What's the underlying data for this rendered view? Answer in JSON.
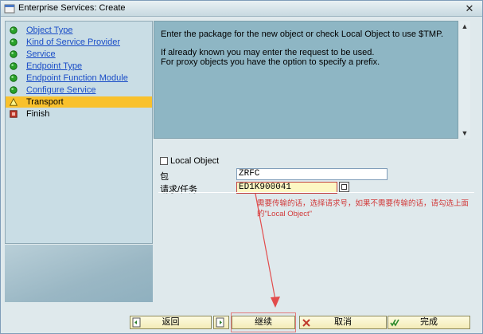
{
  "window": {
    "title": "Enterprise Services: Create",
    "close_glyph": "✕"
  },
  "nav": {
    "items": [
      {
        "label": "Object Type",
        "status": "done",
        "icon": "green-dot-icon",
        "color": "#2aa12a"
      },
      {
        "label": "Kind of Service Provider",
        "status": "done",
        "icon": "green-dot-icon",
        "color": "#2aa12a"
      },
      {
        "label": "Service",
        "status": "done",
        "icon": "green-dot-icon",
        "color": "#2aa12a"
      },
      {
        "label": "Endpoint Type",
        "status": "done",
        "icon": "green-dot-icon",
        "color": "#2aa12a"
      },
      {
        "label": "Endpoint Function Module",
        "status": "done",
        "icon": "green-dot-icon",
        "color": "#2aa12a"
      },
      {
        "label": "Configure Service",
        "status": "done",
        "icon": "green-dot-icon",
        "color": "#2aa12a"
      },
      {
        "label": "Transport",
        "status": "current",
        "icon": "warning-triangle-icon",
        "color": "#f9c12c"
      },
      {
        "label": "Finish",
        "status": "pending",
        "icon": "red-square-icon",
        "color": "#c0392b"
      }
    ]
  },
  "info": {
    "line1": "Enter the package for the new object or check Local Object to use $TMP.",
    "line2": "If already known you may enter the request to be used.",
    "line3": "For proxy objects you have the option to specify a prefix."
  },
  "form": {
    "local_object_label": "Local Object",
    "package_label": "包",
    "package_value": "ZRFC",
    "request_label": "请求/任务",
    "request_value": "ED1K900041"
  },
  "annotation": {
    "line1": "需要传输的话，选择请求号，如果不需要传输的话，请勾选上面",
    "line2": "的\"Local Object\""
  },
  "buttons": {
    "back": "返回",
    "continue": "继续",
    "cancel": "取消",
    "complete": "完成"
  }
}
